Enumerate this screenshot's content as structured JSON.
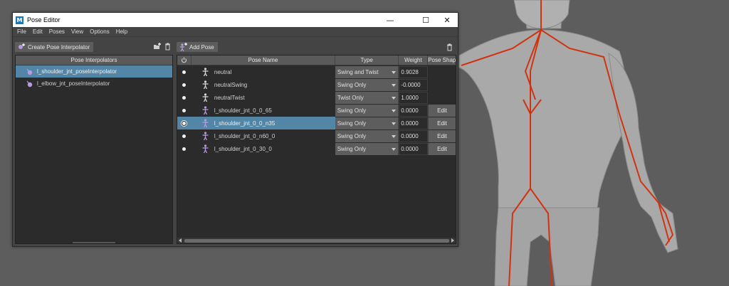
{
  "window": {
    "title": "Pose Editor",
    "app_icon": "M",
    "minimize": "—",
    "maximize": "☐",
    "close": "✕"
  },
  "menu": [
    "File",
    "Edit",
    "Poses",
    "View",
    "Options",
    "Help"
  ],
  "left_panel": {
    "create_button": "Create Pose Interpolator",
    "header": "Pose Interpolators",
    "items": [
      {
        "label": "l_shoulder_jnt_poseInterpolator",
        "selected": true
      },
      {
        "label": "l_elbow_jnt_poseInterpolator",
        "selected": false
      }
    ]
  },
  "right_panel": {
    "add_button": "Add Pose",
    "columns": {
      "name": "Pose Name",
      "type": "Type",
      "weight": "Weight",
      "shape": "Pose Shap"
    },
    "rows": [
      {
        "name": "neutral",
        "type": "Swing and Twist",
        "weight": "0.9028",
        "edit": ""
      },
      {
        "name": "neutralSwing",
        "type": "Swing Only",
        "weight": "-0.0000",
        "edit": ""
      },
      {
        "name": "neutralTwist",
        "type": "Twist Only",
        "weight": "1.0000",
        "edit": ""
      },
      {
        "name": "l_shoulder_jnt_0_0_65",
        "type": "Swing Only",
        "weight": "0.0000",
        "edit": "Edit"
      },
      {
        "name": "l_shoulder_jnt_0_0_n35",
        "type": "Swing Only",
        "weight": "0.0000",
        "edit": "Edit"
      },
      {
        "name": "l_shoulder_jnt_0_n60_0",
        "type": "Swing Only",
        "weight": "0.0000",
        "edit": "Edit"
      },
      {
        "name": "l_shoulder_jnt_0_30_0",
        "type": "Swing Only",
        "weight": "0.0000",
        "edit": "Edit"
      }
    ]
  },
  "colors": {
    "selection": "#5285a6",
    "skeleton": "#d0330f",
    "pose_icon_neutral": "#d8d8d8",
    "pose_icon_custom": "#b79be0"
  }
}
